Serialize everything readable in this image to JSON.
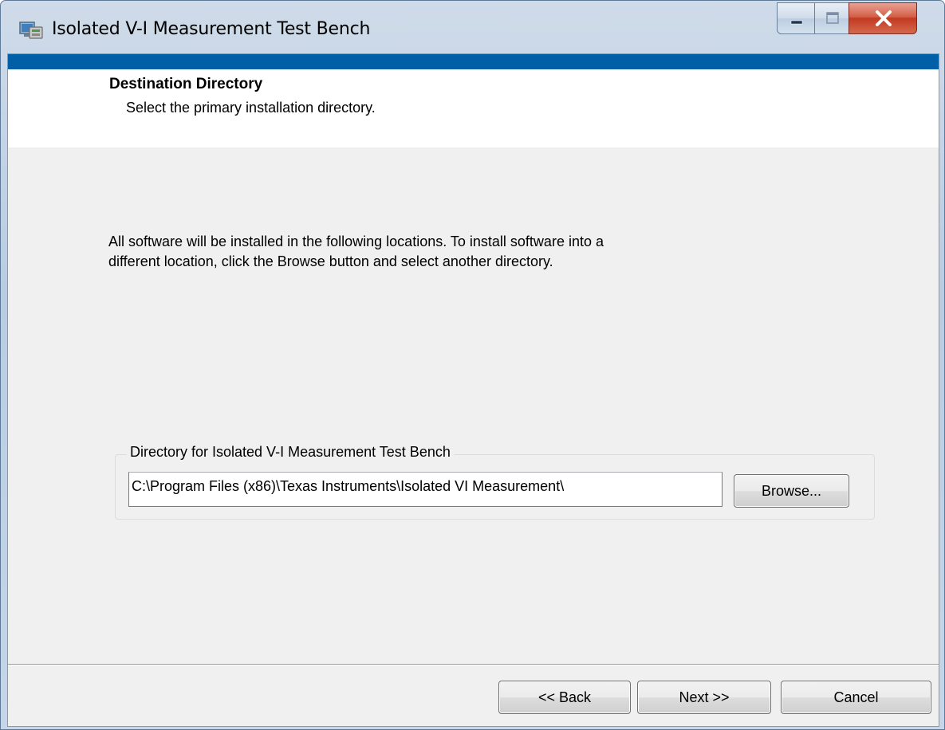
{
  "window": {
    "title": "Isolated V-I Measurement Test Bench",
    "controls": {
      "minimize": "minimize-icon",
      "maximize": "maximize-icon",
      "close": "close-icon"
    }
  },
  "header": {
    "title": "Destination Directory",
    "subtitle": "Select the primary installation directory."
  },
  "body": {
    "instructions": "All software will be installed in the following locations. To install software into a\ndifferent location, click the Browse button and select another directory."
  },
  "directory": {
    "group_label": "Directory for Isolated V-I Measurement Test Bench",
    "path": "C:\\Program Files (x86)\\Texas Instruments\\Isolated VI Measurement\\",
    "browse_label": "Browse..."
  },
  "footer": {
    "back_label": "<< Back",
    "next_label": "Next >>",
    "cancel_label": "Cancel"
  },
  "colors": {
    "accent_band": "#005fa6",
    "close_button": "#c23a20",
    "dialog_background": "#f0f0f0"
  }
}
